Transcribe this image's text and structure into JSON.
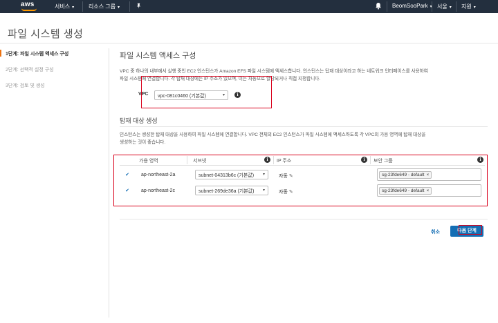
{
  "topnav": {
    "logo_text": "aws",
    "services": "서비스",
    "resource_groups": "리소스 그룹",
    "user": "BeomSooPark",
    "region": "서울",
    "support": "지원",
    "bg_color": "#232f3e",
    "accent": "#ff9900"
  },
  "page": {
    "title": "파일 시스템 생성"
  },
  "steps": [
    {
      "label": "1단계: 파일 시스템 액세스 구성",
      "active": true
    },
    {
      "label": "2단계: 선택적 설정 구성",
      "active": false
    },
    {
      "label": "3단계: 검토 및 생성",
      "active": false
    }
  ],
  "main": {
    "section_title": "파일 시스템 액세스 구성",
    "desc_line1": "VPC 중 하나의 내부에서 실행 중인 EC2 인스턴스가 Amazon EFS 파일 시스템에 액세스합니다. 인스턴스는 탑재 대상이라고 하는 네트워크 인터페이스를 사용하여",
    "desc_line2": "파일 시스템에 연결합니다. 각 탑재 대상에는 IP 주소가 있으며, 이는 자동으로 할당되거나 직접 지정합니다.",
    "vpc_label": "VPC",
    "vpc_value": "vpc-081c0460 (기본값)",
    "mount_title": "탑재 대상 생성",
    "mount_desc1": "인스턴스는 생성한 탑재 대상을 사용하여 파일 시스템에 연결합니다. VPC 전체의 EC2 인스턴스가 파일 시스템에 액세스하도록 각 VPC의 가용 영역에 탑재 대상을",
    "mount_desc2": "생성하는 것이 좋습니다."
  },
  "table": {
    "headers": {
      "az": "가용 영역",
      "subnet": "서브넷",
      "ip": "IP 주소",
      "sg": "보안 그룹"
    },
    "rows": [
      {
        "az": "ap-northeast-2a",
        "subnet": "subnet-04313b6c (기본값)",
        "ip": "자동",
        "sg": "sg-23fde649 - default"
      },
      {
        "az": "ap-northeast-2c",
        "subnet": "subnet-269de36a (기본값)",
        "ip": "자동",
        "sg": "sg-23fde649 - default"
      }
    ]
  },
  "footer": {
    "cancel": "취소",
    "next": "다음 단계",
    "primary_color": "#146eb4"
  },
  "highlight_color": "#d9001b"
}
